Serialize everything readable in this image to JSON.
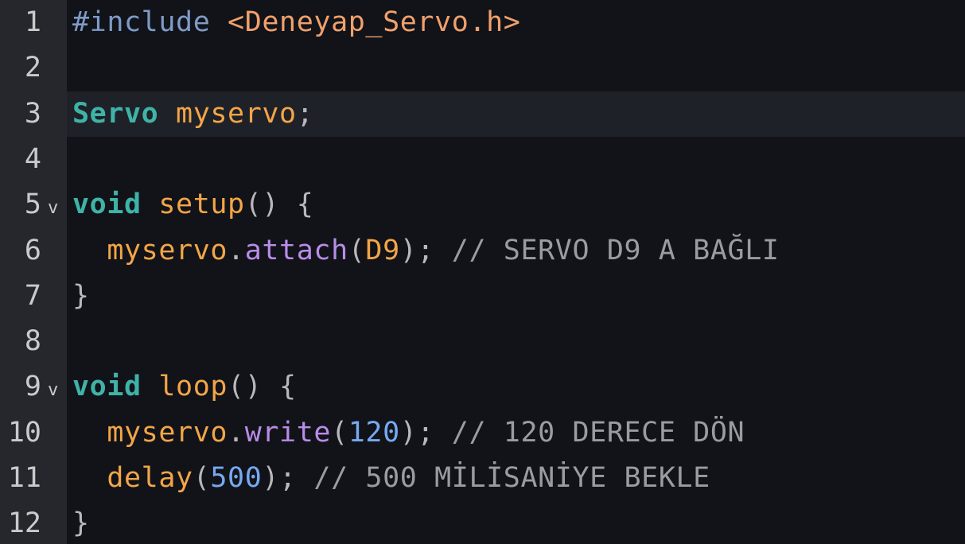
{
  "editor": {
    "lines": [
      {
        "num": "1",
        "parts": [
          {
            "t": "#include",
            "c": "pre"
          },
          {
            "t": " ",
            "c": "punc"
          },
          {
            "t": "<Deneyap_Servo.h>",
            "c": "str"
          }
        ]
      },
      {
        "num": "2",
        "parts": []
      },
      {
        "num": "3",
        "current": true,
        "parts": [
          {
            "t": "Servo",
            "c": "kw"
          },
          {
            "t": " ",
            "c": "punc"
          },
          {
            "t": "myservo",
            "c": "id"
          },
          {
            "t": ";",
            "c": "punc"
          }
        ]
      },
      {
        "num": "4",
        "parts": []
      },
      {
        "num": "5",
        "fold": "v",
        "parts": [
          {
            "t": "void",
            "c": "kw"
          },
          {
            "t": " ",
            "c": "punc"
          },
          {
            "t": "setup",
            "c": "id"
          },
          {
            "t": "() {",
            "c": "punc"
          }
        ]
      },
      {
        "num": "6",
        "parts": [
          {
            "t": "  ",
            "c": "punc"
          },
          {
            "t": "myservo",
            "c": "id"
          },
          {
            "t": ".",
            "c": "punc"
          },
          {
            "t": "attach",
            "c": "meth"
          },
          {
            "t": "(",
            "c": "punc"
          },
          {
            "t": "D9",
            "c": "id"
          },
          {
            "t": "); ",
            "c": "punc"
          },
          {
            "t": "// SERVO D9 A BAĞLI",
            "c": "comment"
          }
        ]
      },
      {
        "num": "7",
        "parts": [
          {
            "t": "}",
            "c": "punc"
          }
        ]
      },
      {
        "num": "8",
        "parts": []
      },
      {
        "num": "9",
        "fold": "v",
        "parts": [
          {
            "t": "void",
            "c": "kw"
          },
          {
            "t": " ",
            "c": "punc"
          },
          {
            "t": "loop",
            "c": "id"
          },
          {
            "t": "() {",
            "c": "punc"
          }
        ]
      },
      {
        "num": "10",
        "parts": [
          {
            "t": "  ",
            "c": "punc"
          },
          {
            "t": "myservo",
            "c": "id"
          },
          {
            "t": ".",
            "c": "punc"
          },
          {
            "t": "write",
            "c": "meth"
          },
          {
            "t": "(",
            "c": "punc"
          },
          {
            "t": "120",
            "c": "num"
          },
          {
            "t": "); ",
            "c": "punc"
          },
          {
            "t": "// 120 DERECE DÖN",
            "c": "comment"
          }
        ]
      },
      {
        "num": "11",
        "parts": [
          {
            "t": "  ",
            "c": "punc"
          },
          {
            "t": "delay",
            "c": "id"
          },
          {
            "t": "(",
            "c": "punc"
          },
          {
            "t": "500",
            "c": "num"
          },
          {
            "t": "); ",
            "c": "punc"
          },
          {
            "t": "// 500 MİLİSANİYE BEKLE",
            "c": "comment"
          }
        ]
      },
      {
        "num": "12",
        "parts": [
          {
            "t": "}",
            "c": "punc"
          }
        ]
      }
    ]
  },
  "colors": {
    "background": "#111319",
    "gutter": "#26272d",
    "current_line": "#1f2128",
    "keyword": "#3fb3a7",
    "identifier": "#f3a547",
    "method": "#b98ce8",
    "number": "#76a9f0",
    "comment": "#9a9ca1"
  }
}
